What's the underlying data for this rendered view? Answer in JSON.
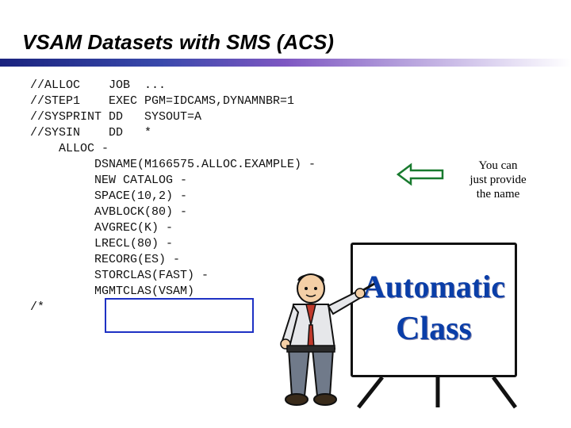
{
  "title": "VSAM Datasets with SMS (ACS)",
  "code": {
    "l1": "//ALLOC    JOB  ...",
    "l2": "//STEP1    EXEC PGM=IDCAMS,DYNAMNBR=1",
    "l3": "//SYSPRINT DD   SYSOUT=A",
    "l4": "//SYSIN    DD   *",
    "l5": "    ALLOC -",
    "l6": "         DSNAME(M166575.ALLOC.EXAMPLE) -",
    "l7": "         NEW CATALOG -",
    "l8": "         SPACE(10,2) -",
    "l9": "         AVBLOCK(80) -",
    "l10": "         AVGREC(K) -",
    "l11": "         LRECL(80) -",
    "l12": "         RECORG(ES) -",
    "l13": "         STORCLAS(FAST) -",
    "l14": "         MGMTCLAS(VSAM)",
    "l15": "/*"
  },
  "callout": {
    "line1": "You can",
    "line2": "just provide",
    "line3": "the name"
  },
  "board": {
    "word1": "Automatic",
    "word2": "Class"
  }
}
